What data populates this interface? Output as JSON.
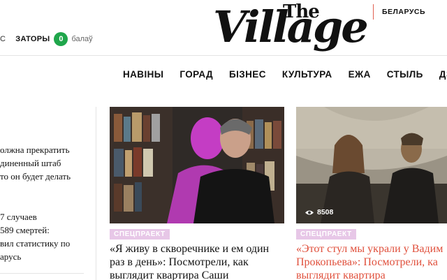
{
  "traffic": {
    "cut_text": "С",
    "label": "ЗАТОРЫ",
    "score": "0",
    "description": "балаў"
  },
  "logo": {
    "the": "The",
    "village": "Village"
  },
  "region": "БЕЛАРУСЬ",
  "nav": [
    "НАВІНЫ",
    "ГОРАД",
    "БІЗНЕС",
    "КУЛЬТУРА",
    "ЕЖА",
    "СТЫЛЬ",
    "ДЗЕ"
  ],
  "sidebar_news": [
    {
      "lines": [
        "олжна прекратить",
        "диненный штаб",
        "то он будет делать"
      ]
    },
    {
      "lines": [
        "7 случаев",
        "589 смертей:",
        "вил статистику по",
        "арусь"
      ]
    }
  ],
  "cards": [
    {
      "badge": "СПЕЦПРАЕКТ",
      "headline": [
        "«Я живу в скворечнике и ем один",
        "раз в день»: Посмотрели, как",
        "выглядит квартира Саши"
      ]
    },
    {
      "badge": "СПЕЦПРАЕКТ",
      "views": "8508",
      "headline": [
        "«Этот стул мы украли у Вадим",
        "Прокопьева»: Посмотрели, ка",
        "выглядит квартира"
      ]
    }
  ],
  "colors": {
    "accent": "#e0503c",
    "badge": "#e7c7e7",
    "traffic_green": "#1fa64b"
  }
}
